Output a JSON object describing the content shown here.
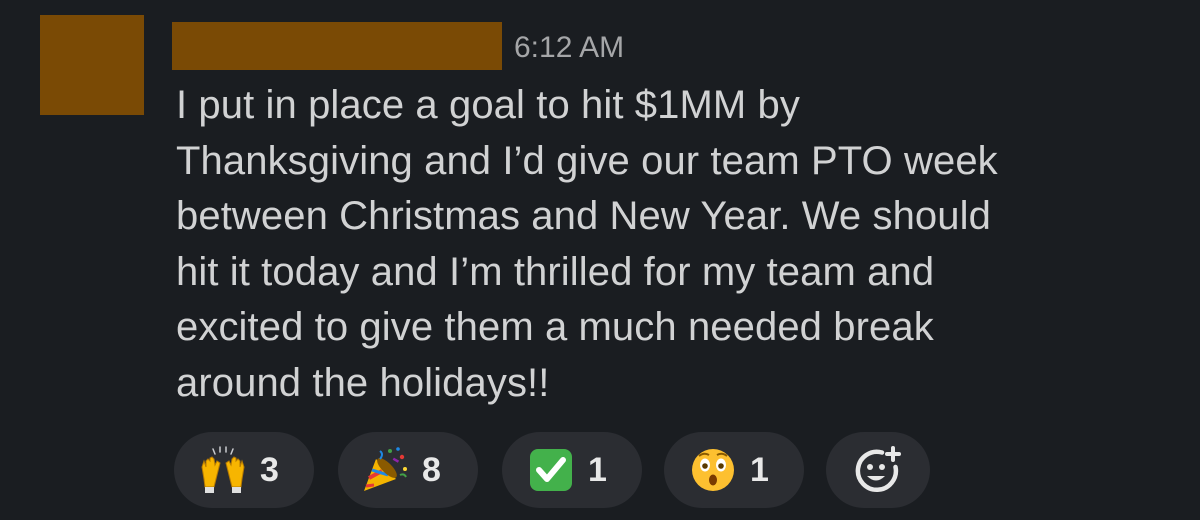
{
  "message": {
    "timestamp": "6:12 AM",
    "lines": [
      "I put in place a goal to hit $1MM by",
      "Thanksgiving and I’d give our team PTO week",
      "between Christmas and New Year. We should",
      "hit it today and I’m thrilled for my team and",
      "excited to give them a much needed break",
      "around the holidays!!"
    ]
  },
  "colors": {
    "background": "#1a1d21",
    "redaction": "#7a4a05",
    "reaction_pill": "#2b2d32"
  },
  "reactions": [
    {
      "icon": "raised-hands-icon",
      "count": "3"
    },
    {
      "icon": "party-popper-icon",
      "count": "8"
    },
    {
      "icon": "white-check-mark-icon",
      "count": "1"
    },
    {
      "icon": "hushed-face-icon",
      "count": "1"
    },
    {
      "icon": "add-reaction-icon"
    }
  ]
}
